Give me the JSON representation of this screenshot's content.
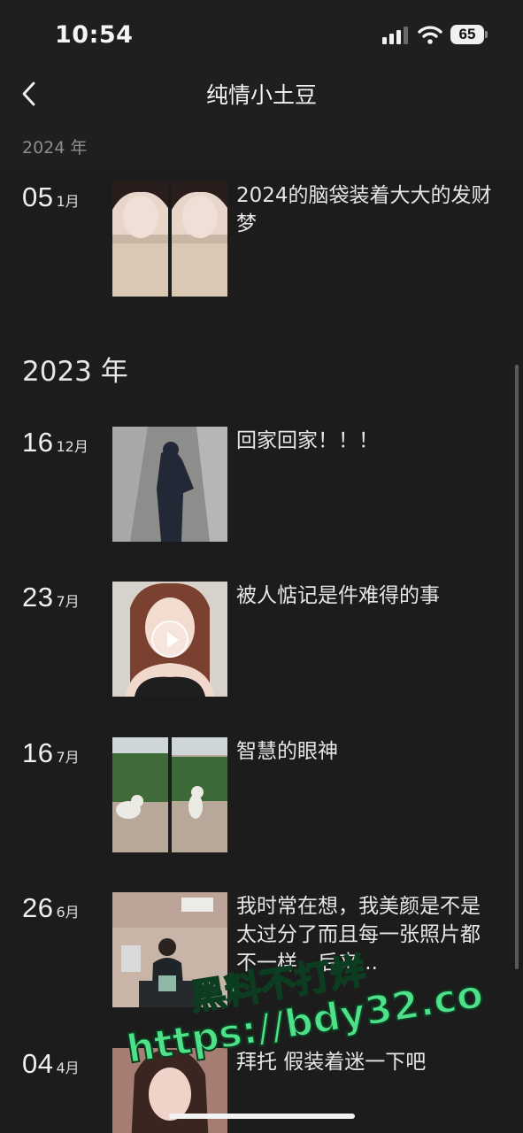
{
  "status_bar": {
    "time": "10:54",
    "battery": "65"
  },
  "nav": {
    "title": "纯情小土豆"
  },
  "sticky_year": "2024 年",
  "years": [
    {
      "label": "2023 年"
    }
  ],
  "entries": [
    {
      "day": "05",
      "month": "1月",
      "text": "2024的脑袋装着大大的发财梦",
      "thumb": "selfie-collage",
      "video": false
    },
    {
      "day": "16",
      "month": "12月",
      "text": "回家回家！！！",
      "thumb": "snow-shadow",
      "video": false
    },
    {
      "day": "23",
      "month": "7月",
      "text": "被人惦记是件难得的事",
      "thumb": "selfie-video",
      "video": true
    },
    {
      "day": "16",
      "month": "7月",
      "text": "智慧的眼神",
      "thumb": "dog-collage",
      "video": false
    },
    {
      "day": "26",
      "month": "6月",
      "text": "我时常在想，我美颜是不是太过分了而且每一张照片都不一样，后来...",
      "thumb": "salon-mirror",
      "video": false
    },
    {
      "day": "04",
      "month": "4月",
      "text": "拜托 假装着迷一下吧",
      "thumb": "portrait",
      "video": false
    }
  ],
  "watermark": {
    "line1": "黑料不打烊",
    "line2": "https://bdy32.co"
  },
  "icons": {
    "back": "chevron-left-icon",
    "signal": "cellular-signal-icon",
    "wifi": "wifi-icon",
    "battery": "battery-icon",
    "play": "play-icon"
  },
  "colors": {
    "background": "#1c1c1c",
    "header": "#1f1f1f",
    "watermark": "#4fe08a"
  }
}
